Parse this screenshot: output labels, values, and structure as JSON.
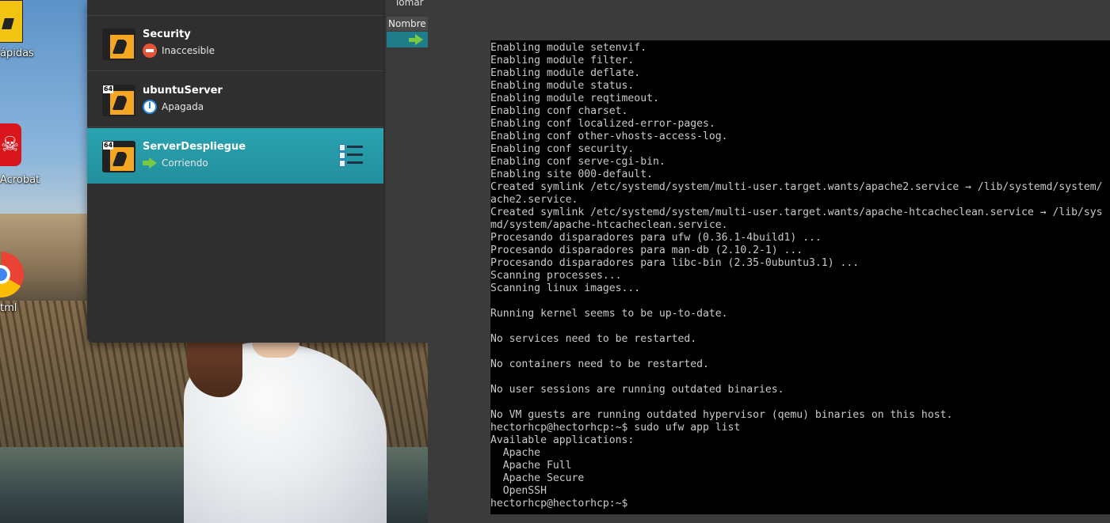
{
  "desktop": {
    "icons": [
      {
        "label": "ápidas",
        "icon": "shortcut-icon"
      },
      {
        "label": "Acrobat",
        "icon": "acrobat-icon"
      },
      {
        "label": "tml",
        "icon": "chrome-icon"
      }
    ]
  },
  "virtualbox": {
    "vms": [
      {
        "name": "Security",
        "status": "Inaccesible",
        "status_icon": "inaccessible-icon"
      },
      {
        "name": "ubuntuServer",
        "status": "Apagada",
        "status_icon": "power-off-icon",
        "badge": "64"
      },
      {
        "name": "ServerDespliegue",
        "status": "Corriendo",
        "status_icon": "running-arrow-icon",
        "badge": "64",
        "selected": true
      }
    ],
    "side_pane": {
      "title": "Tomar",
      "column_header": "Nombre"
    },
    "colors": {
      "selection": "#2aa3b1",
      "running": "#7ac943",
      "inaccessible": "#e5533b"
    }
  },
  "terminal": {
    "lines": [
      "Enabling module setenvif.",
      "Enabling module filter.",
      "Enabling module deflate.",
      "Enabling module status.",
      "Enabling module reqtimeout.",
      "Enabling conf charset.",
      "Enabling conf localized-error-pages.",
      "Enabling conf other-vhosts-access-log.",
      "Enabling conf security.",
      "Enabling conf serve-cgi-bin.",
      "Enabling site 000-default.",
      "Created symlink /etc/systemd/system/multi-user.target.wants/apache2.service → /lib/systemd/system/",
      "ache2.service.",
      "Created symlink /etc/systemd/system/multi-user.target.wants/apache-htcacheclean.service → /lib/sys",
      "md/system/apache-htcacheclean.service.",
      "Procesando disparadores para ufw (0.36.1-4build1) ...",
      "Procesando disparadores para man-db (2.10.2-1) ...",
      "Procesando disparadores para libc-bin (2.35-0ubuntu3.1) ...",
      "Scanning processes...",
      "Scanning linux images...",
      "",
      "Running kernel seems to be up-to-date.",
      "",
      "No services need to be restarted.",
      "",
      "No containers need to be restarted.",
      "",
      "No user sessions are running outdated binaries.",
      "",
      "No VM guests are running outdated hypervisor (qemu) binaries on this host.",
      "hectorhcp@hectorhcp:~$ sudo ufw app list",
      "Available applications:",
      "  Apache",
      "  Apache Full",
      "  Apache Secure",
      "  OpenSSH",
      "hectorhcp@hectorhcp:~$"
    ]
  }
}
